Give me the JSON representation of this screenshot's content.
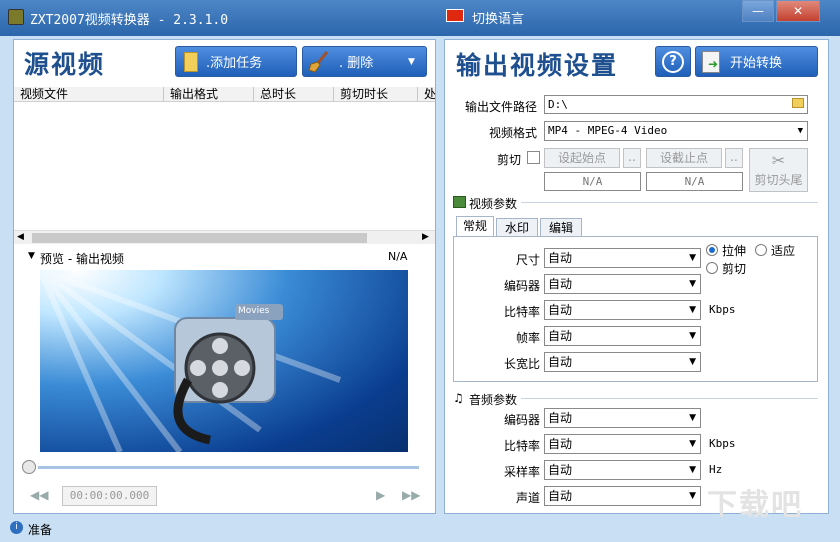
{
  "window": {
    "title": "ZXT2007视频转换器 - 2.3.1.0",
    "language_label": "切换语言",
    "minimize_label": "—",
    "close_label": "✕"
  },
  "left": {
    "header": "源视频",
    "add_task_label": ".添加任务",
    "delete_label": ". 删除",
    "columns": [
      "视频文件",
      "输出格式",
      "总时长",
      "剪切时长",
      "处"
    ],
    "preview_label": "预览 - 输出视频",
    "preview_value": "N/A",
    "movie_tag": "Movies",
    "time_display": "00:00:00.000"
  },
  "right": {
    "header": "输出视频设置",
    "help_label": "?",
    "start_label": "开始转换",
    "output_path_label": "输出文件路径",
    "output_path_value": "D:\\",
    "format_label": "视频格式",
    "format_value": "MP4 - MPEG-4 Video",
    "cut_label": "剪切",
    "set_start_label": "设起始点",
    "set_end_label": "设截止点",
    "dots": "..",
    "start_value": "N/A",
    "end_value": "N/A",
    "cut_headtail_label": "剪切头尾",
    "video_params_label": "视频参数",
    "tabs": [
      "常规",
      "水印",
      "编辑"
    ],
    "video_rows": [
      {
        "label": "尺寸",
        "value": "自动"
      },
      {
        "label": "编码器",
        "value": "自动"
      },
      {
        "label": "比特率",
        "value": "自动"
      },
      {
        "label": "帧率",
        "value": "自动"
      },
      {
        "label": "长宽比",
        "value": "自动"
      }
    ],
    "video_bitrate_unit": "Kbps",
    "radio_stretch": "拉伸",
    "radio_fit": "适应",
    "radio_crop": "剪切",
    "audio_params_label": "音频参数",
    "audio_rows": [
      {
        "label": "编码器",
        "value": "自动"
      },
      {
        "label": "比特率",
        "value": "自动"
      },
      {
        "label": "采样率",
        "value": "自动"
      },
      {
        "label": "声道",
        "value": "自动"
      }
    ],
    "audio_bitrate_unit": "Kbps",
    "samplerate_unit": "Hz"
  },
  "status": {
    "text": "准备"
  },
  "watermark": "下载吧"
}
